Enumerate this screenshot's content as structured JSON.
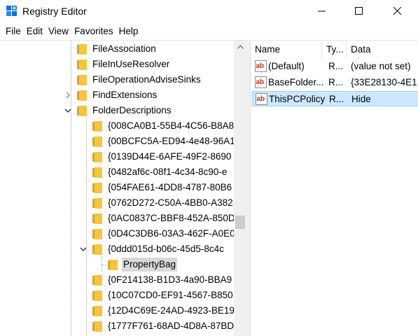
{
  "window": {
    "title": "Registry Editor",
    "icon": "registry-icon"
  },
  "menu": [
    "File",
    "Edit",
    "View",
    "Favorites",
    "Help"
  ],
  "tree": {
    "items": [
      {
        "label": "FileAssociation",
        "level": 0,
        "expander": "none",
        "selected": false
      },
      {
        "label": "FileInUseResolver",
        "level": 0,
        "expander": "none",
        "selected": false
      },
      {
        "label": "FileOperationAdviseSinks",
        "level": 0,
        "expander": "none",
        "selected": false
      },
      {
        "label": "FindExtensions",
        "level": 0,
        "expander": "collapsed",
        "selected": false
      },
      {
        "label": "FolderDescriptions",
        "level": 0,
        "expander": "expanded",
        "selected": false
      },
      {
        "label": "{008CA0B1-55B4-4C56-B8A8",
        "level": 1,
        "expander": "none",
        "selected": false
      },
      {
        "label": "{00BCFC5A-ED94-4e48-96A1",
        "level": 1,
        "expander": "none",
        "selected": false
      },
      {
        "label": "{0139D44E-6AFE-49F2-8690",
        "level": 1,
        "expander": "none",
        "selected": false
      },
      {
        "label": "{0482af6c-08f1-4c34-8c90-e",
        "level": 1,
        "expander": "none",
        "selected": false
      },
      {
        "label": "{054FAE61-4DD8-4787-80B6",
        "level": 1,
        "expander": "none",
        "selected": false
      },
      {
        "label": "{0762D272-C50A-4BB0-A382",
        "level": 1,
        "expander": "none",
        "selected": false
      },
      {
        "label": "{0AC0837C-BBF8-452A-850D",
        "level": 1,
        "expander": "none",
        "selected": false
      },
      {
        "label": "{0D4C3DB6-03A3-462F-A0E0",
        "level": 1,
        "expander": "none",
        "selected": false
      },
      {
        "label": "{0ddd015d-b06c-45d5-8c4c",
        "level": 1,
        "expander": "expanded",
        "selected": false
      },
      {
        "label": "PropertyBag",
        "level": 2,
        "expander": "none",
        "selected": true
      },
      {
        "label": "{0F214138-B1D3-4a90-BBA9",
        "level": 1,
        "expander": "none",
        "selected": false
      },
      {
        "label": "{10C07CD0-EF91-4567-B850",
        "level": 1,
        "expander": "none",
        "selected": false
      },
      {
        "label": "{12D4C69E-24AD-4923-BE19",
        "level": 1,
        "expander": "none",
        "selected": false
      },
      {
        "label": "{1777F761-68AD-4D8A-87BD",
        "level": 1,
        "expander": "none",
        "selected": false
      }
    ]
  },
  "list": {
    "columns": [
      "Name",
      "Ty...",
      "Data"
    ],
    "rows": [
      {
        "name": "(Default)",
        "type": "R...",
        "data": "(value not set)",
        "icon": "string-value-icon",
        "selected": false
      },
      {
        "name": "BaseFolder...",
        "type": "R...",
        "data": "{33E28130-4E1",
        "icon": "string-value-icon",
        "selected": false
      },
      {
        "name": "ThisPCPolicy",
        "type": "R...",
        "data": "Hide",
        "icon": "string-value-icon",
        "selected": true
      }
    ]
  },
  "colors": {
    "folder": "#f5c542",
    "folder_dark": "#dca429",
    "selection_list": "#cce8ff",
    "selection_tree": "#d9d9d9",
    "ab_icon_red": "#c42b1c"
  }
}
